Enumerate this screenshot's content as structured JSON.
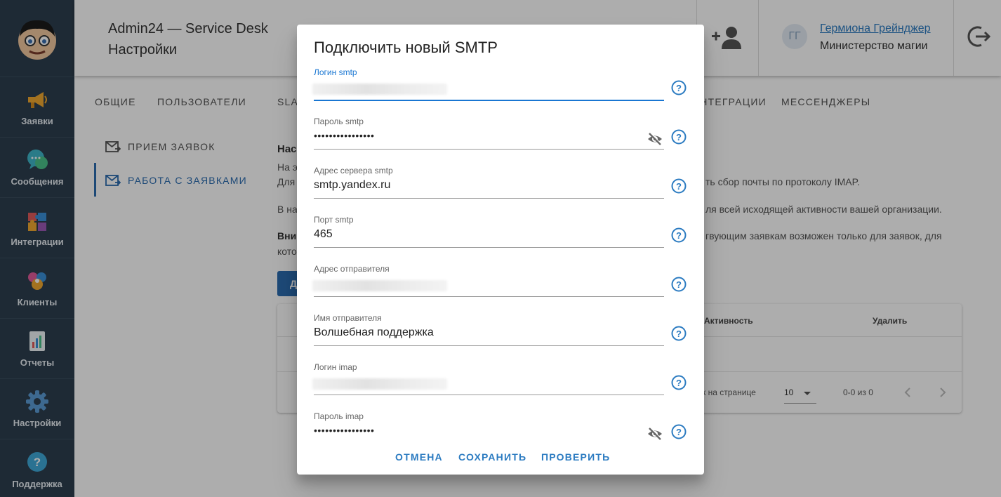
{
  "header": {
    "app_title": "Admin24 — Service Desk",
    "page_title": "Настройки",
    "user_initials": "ГГ",
    "user_name": "Гермиона Грейнджер",
    "user_org": "Министерство магии"
  },
  "sidebar": {
    "items": [
      {
        "label": "Заявки",
        "icon": "megaphone-icon"
      },
      {
        "label": "Сообщения",
        "icon": "chat-bubbles-icon"
      },
      {
        "label": "Интеграции",
        "icon": "puzzle-icon"
      },
      {
        "label": "Клиенты",
        "icon": "clients-icon"
      },
      {
        "label": "Отчеты",
        "icon": "report-icon"
      },
      {
        "label": "Настройки",
        "icon": "gear-icon"
      },
      {
        "label": "Поддержка",
        "icon": "help-icon"
      }
    ]
  },
  "tabs": [
    "ОБЩИЕ",
    "ПОЛЬЗОВАТЕЛИ",
    "SLA",
    "ИНТЕГРАЦИИ",
    "МЕССЕНДЖЕРЫ"
  ],
  "subnav": {
    "items": [
      "ПРИЕМ ЗАЯВОК",
      "РАБОТА С ЗАЯВКАМИ"
    ]
  },
  "content": {
    "heading": "Нас",
    "line1": "На э",
    "line2_start": "Для",
    "line2_end": "ть сбор почты по протоколу IMAP.",
    "line3_start": "В на",
    "line3_end": "ля всей исходящей активности вашей организации.",
    "line4_start": "Вни",
    "line4_end": "гвующим заявкам возможен только для заявок, для",
    "line5_start": "кото",
    "add_button": "Д"
  },
  "table": {
    "col_active": "Активность",
    "col_delete": "Удалить",
    "rows_per_page_label": "к на странице",
    "rows_per_page": "10",
    "range": "0-0 из 0"
  },
  "dialog": {
    "title": "Подключить новый SMTP",
    "fields": [
      {
        "label": "Логин smtp",
        "value": ""
      },
      {
        "label": "Пароль smtp",
        "value": "••••••••••••••••"
      },
      {
        "label": "Адрес сервера smtp",
        "value": "smtp.yandex.ru"
      },
      {
        "label": "Порт smtp",
        "value": "465"
      },
      {
        "label": "Адрес отправителя",
        "value": ""
      },
      {
        "label": "Имя отправителя",
        "value": "Волшебная поддержка"
      },
      {
        "label": "Логин imap",
        "value": ""
      },
      {
        "label": "Пароль imap",
        "value": "••••••••••••••••"
      }
    ],
    "buttons": {
      "cancel": "ОТМЕНА",
      "save": "СОХРАНИТЬ",
      "check": "ПРОВЕРИТЬ"
    }
  },
  "colors": {
    "sidebar_bg": "#2d3e4e",
    "accent": "#2b7bc1",
    "focus": "#1976d2"
  }
}
